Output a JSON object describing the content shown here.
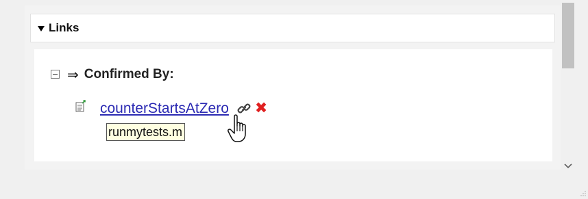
{
  "section": {
    "title": "Links",
    "toggle_icon": "triangle-down-icon"
  },
  "group": {
    "collapse_icon": "collapse-minus-icon",
    "arrow_icon": "⇒",
    "label": "Confirmed By:"
  },
  "link": {
    "doc_icon": "test-document-icon",
    "text": "counterStartsAtZero",
    "chain_icon": "chain-link-icon",
    "delete_icon": "✖"
  },
  "tooltip": {
    "text": "runmytests.m"
  },
  "colors": {
    "link": "#2b2ab3",
    "delete": "#e02020",
    "tooltip_bg": "#ffffe1",
    "scroll_thumb": "#c1c1c1"
  }
}
